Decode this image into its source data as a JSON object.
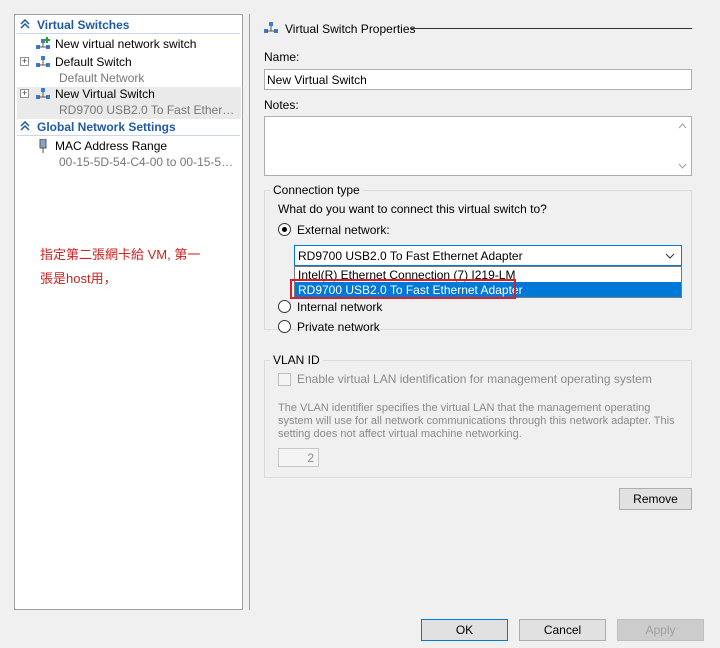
{
  "sidebar": {
    "sections": [
      {
        "title": "Virtual Switches"
      },
      {
        "title": "Global Network Settings"
      }
    ],
    "items": [
      {
        "label": "New virtual network switch",
        "sub": ""
      },
      {
        "label": "Default Switch",
        "sub": "Default Network"
      },
      {
        "label": "New Virtual Switch",
        "sub": "RD9700 USB2.0 To Fast Ethernet ..."
      },
      {
        "label": "MAC Address Range",
        "sub": "00-15-5D-54-C4-00 to 00-15-5D-5..."
      }
    ],
    "annotation_line1": "指定第二張網卡給 VM, 第一",
    "annotation_line2": "張是host用，"
  },
  "properties": {
    "title": "Virtual Switch Properties",
    "name_label": "Name:",
    "name_value": "New Virtual Switch",
    "notes_label": "Notes:",
    "notes_value": ""
  },
  "connection": {
    "legend": "Connection type",
    "question": "What do you want to connect this virtual switch to?",
    "external_label": "External network:",
    "internal_label": "Internal network",
    "private_label": "Private network",
    "selected_adapter": "RD9700 USB2.0 To Fast Ethernet Adapter",
    "options": [
      "Intel(R) Ethernet Connection (7) I219-LM",
      "RD9700 USB2.0 To Fast Ethernet Adapter"
    ]
  },
  "vlan": {
    "legend": "VLAN ID",
    "checkbox_label": "Enable virtual LAN identification for management operating system",
    "description_line1": "The VLAN identifier specifies the virtual LAN that the management operating",
    "description_line2": "system will use for all network communications through this network adapter. This",
    "description_line3": "setting does not affect virtual machine networking.",
    "vlan_value": "2"
  },
  "buttons": {
    "remove": "Remove",
    "ok": "OK",
    "cancel": "Cancel",
    "apply": "Apply"
  },
  "colors": {
    "section_header": "#1e5aa8",
    "annotation": "#d02020",
    "highlight": "#0078d7",
    "annotation_box": "#d9202a"
  }
}
